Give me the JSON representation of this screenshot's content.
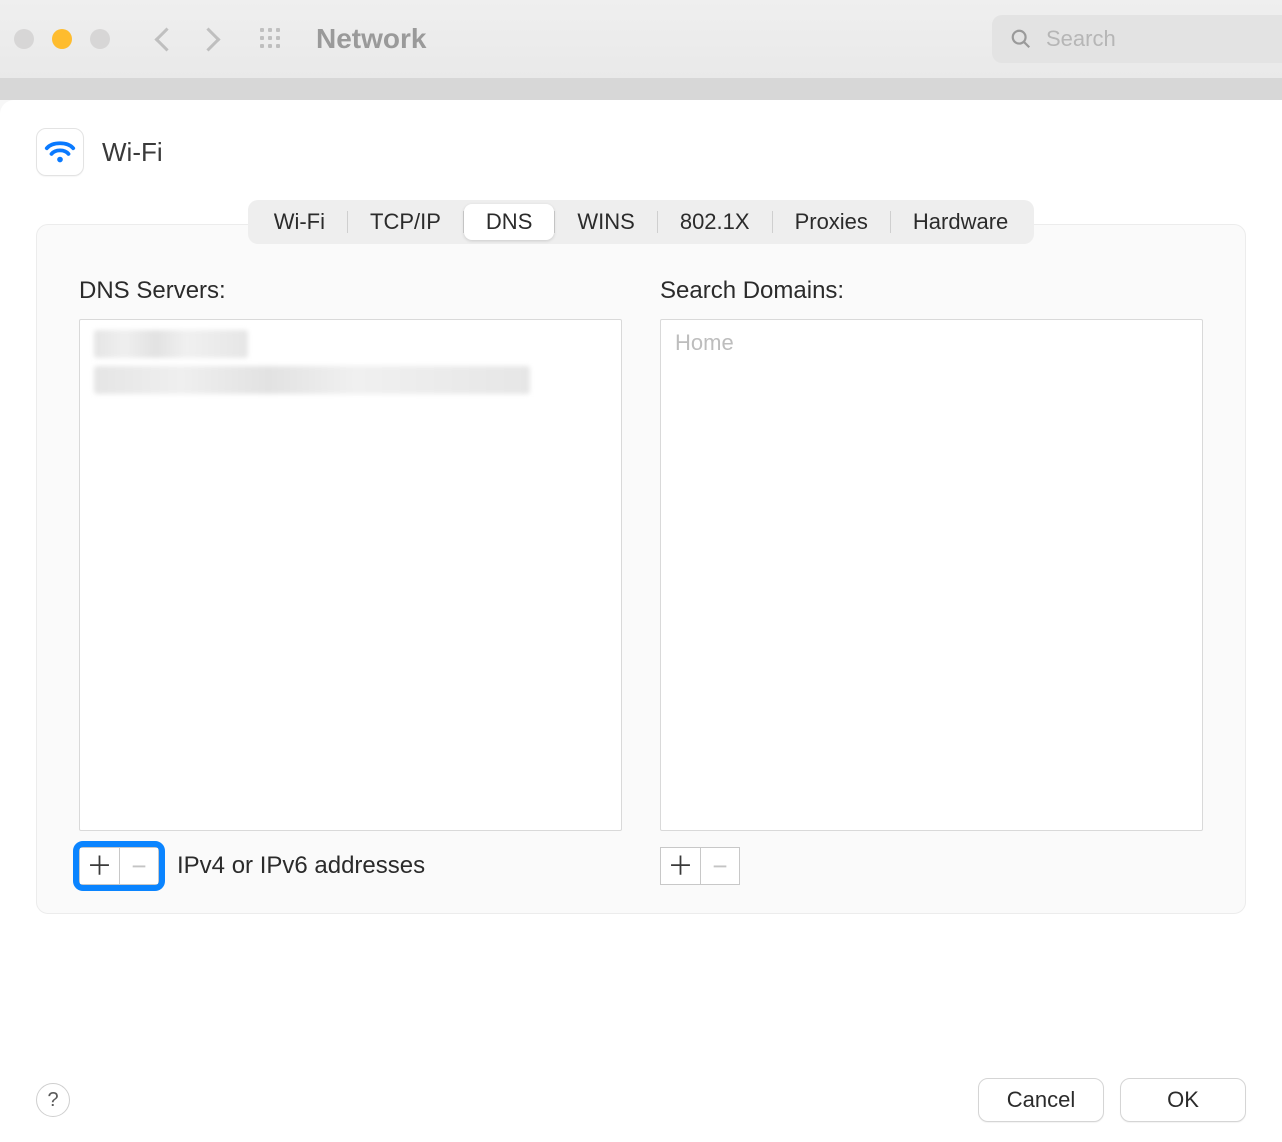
{
  "titlebar": {
    "title": "Network",
    "search_placeholder": "Search"
  },
  "header": {
    "connection_label": "Wi-Fi"
  },
  "tabs": [
    {
      "label": "Wi-Fi",
      "active": false
    },
    {
      "label": "TCP/IP",
      "active": false
    },
    {
      "label": "DNS",
      "active": true
    },
    {
      "label": "WINS",
      "active": false
    },
    {
      "label": "802.1X",
      "active": false
    },
    {
      "label": "Proxies",
      "active": false
    },
    {
      "label": "Hardware",
      "active": false
    }
  ],
  "dns": {
    "servers_label": "DNS Servers:",
    "hint": "IPv4 or IPv6 addresses",
    "add_highlighted": true
  },
  "search_domains": {
    "label": "Search Domains:",
    "items": [
      "Home"
    ]
  },
  "footer": {
    "help_label": "?",
    "cancel_label": "Cancel",
    "ok_label": "OK"
  },
  "glyphs": {
    "plus": "＋",
    "minus": "−"
  }
}
